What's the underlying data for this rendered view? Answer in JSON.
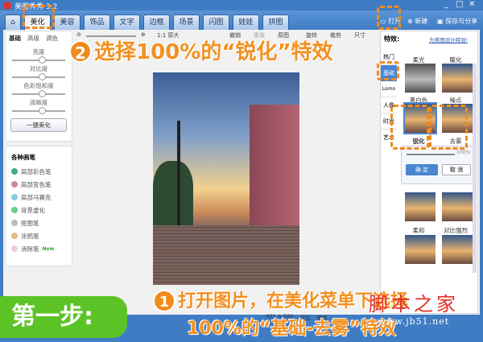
{
  "window": {
    "title": "美图秀秀 3.2",
    "controls": [
      "minimize",
      "maximize",
      "close"
    ]
  },
  "tabs": [
    {
      "label": "美化",
      "active": true
    },
    {
      "label": "美容"
    },
    {
      "label": "饰品"
    },
    {
      "label": "文字"
    },
    {
      "label": "边框"
    },
    {
      "label": "场景"
    },
    {
      "label": "闪图"
    },
    {
      "label": "娃娃"
    },
    {
      "label": "拼图"
    }
  ],
  "top_actions": {
    "open": "打开",
    "new": "新建",
    "save": "保存与分享"
  },
  "left_tabs": [
    "基础",
    "高级",
    "调色"
  ],
  "adjust": {
    "brightness": "亮度",
    "contrast": "对比度",
    "saturation": "色彩饱和度",
    "sharpness": "清晰度",
    "one_click": "一键美化"
  },
  "brushes": {
    "title": "各种画笔",
    "items": [
      "局部彩色笔",
      "局部变色笔",
      "局部马赛克",
      "背景虚化",
      "抠图笔",
      "涂鸦笔",
      "消除笔"
    ],
    "new_badge": "New"
  },
  "toolbar": {
    "zoom_reset": "1:1 原大",
    "undo": "撤销",
    "redo": "重做",
    "reset": "原图",
    "rotate": "旋转",
    "crop": "裁剪",
    "size": "尺寸"
  },
  "effects": {
    "title": "特效:",
    "design_link": "为美图设计特效!",
    "categories": [
      "热门",
      "基础",
      "Lomo",
      "人像",
      "时尚",
      "艺术"
    ],
    "thumbs": [
      "柔光",
      "暖化",
      "黑白色",
      "噪点",
      "锐化",
      "去雾",
      "",
      "",
      "柔和",
      "对比强烈"
    ],
    "strength": "100%",
    "ok": "确 定",
    "cancel": "取 消"
  },
  "status": {
    "size": "401 × 590",
    "compare": "对比",
    "preview": "预览"
  },
  "annotations": {
    "step2": "选择100%的“锐化”特效",
    "step2_num": "2",
    "step1_num": "1",
    "step1_line1": "打开图片，在美化菜单下选择",
    "step1_line2": "100%的“基础-去雾”特效",
    "badge": "第一步:"
  },
  "watermark": {
    "name": "脚本之家",
    "url": "www.jb51.net"
  }
}
